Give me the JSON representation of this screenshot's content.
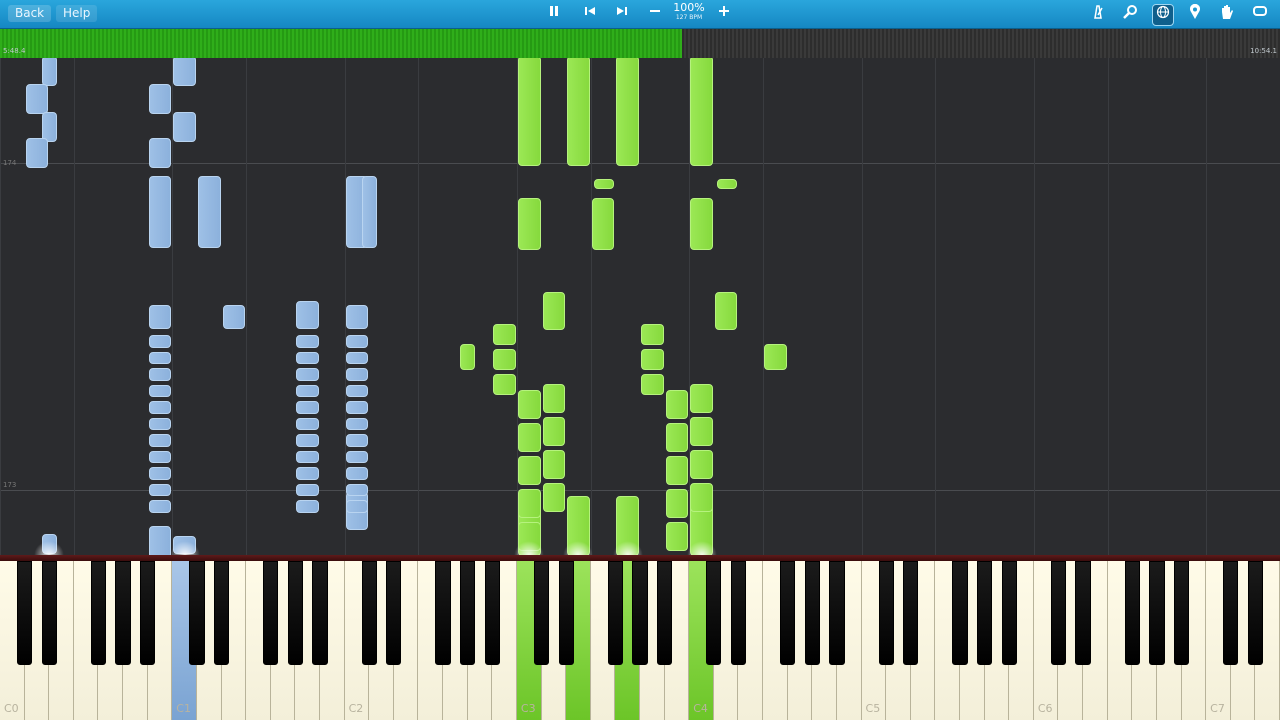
{
  "toolbar": {
    "back_label": "Back",
    "help_label": "Help",
    "speed_percent": "100%",
    "tempo": "127 BPM",
    "icons": [
      "pause-icon",
      "skip-back-icon",
      "skip-forward-icon",
      "slower-icon",
      "faster-icon",
      "metronome-icon",
      "zoom-icon",
      "globe-icon",
      "marker-icon",
      "hand-icon",
      "loop-icon"
    ]
  },
  "progress": {
    "elapsed": "5:48.4",
    "total": "10:54.1",
    "fraction": 0.533
  },
  "measures": [
    "174",
    "173"
  ],
  "keyboard": {
    "octave_labels": [
      "C0",
      "C1",
      "C2",
      "C3",
      "C4",
      "C5",
      "C6",
      "C7"
    ],
    "pressed": {
      "blue": [
        "D#0",
        "C1"
      ],
      "green": [
        "C3",
        "E3",
        "G3",
        "C4"
      ]
    }
  },
  "colors": {
    "left_hand": "#8cb1dc",
    "right_hand": "#86d93d",
    "toolbar": "#1a96d0",
    "progress": "#2fae1a"
  }
}
